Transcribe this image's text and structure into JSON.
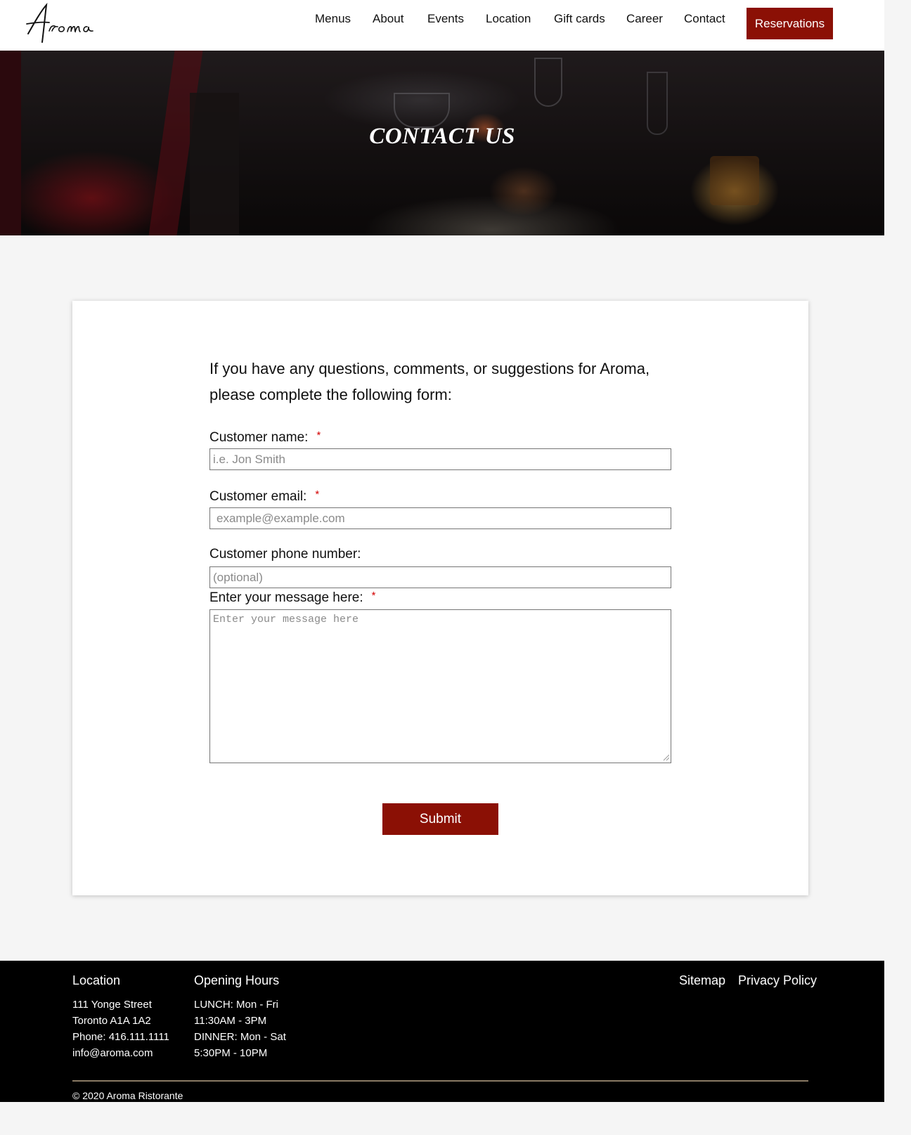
{
  "header": {
    "logo_text": "Aroma",
    "nav": [
      {
        "label": "Menus"
      },
      {
        "label": "About"
      },
      {
        "label": "Events"
      },
      {
        "label": "Location"
      },
      {
        "label": "Gift cards"
      },
      {
        "label": "Career"
      },
      {
        "label": "Contact"
      }
    ],
    "reserve_label": "Reservations"
  },
  "hero": {
    "title": "CONTACT US"
  },
  "form": {
    "intro": "If you have any questions, comments, or suggestions for Aroma, please complete the following form:",
    "required_mark": "*",
    "name": {
      "label": "Customer name:",
      "placeholder": "i.e. Jon Smith"
    },
    "email": {
      "label": "Customer email:",
      "placeholder": "example@example.com"
    },
    "phone": {
      "label": "Customer phone number:",
      "placeholder": "(optional)"
    },
    "message": {
      "label": "Enter your message here:",
      "placeholder": "Enter your message here"
    },
    "submit_label": "Submit"
  },
  "footer": {
    "location": {
      "heading": "Location",
      "lines": [
        "111 Yonge Street",
        "Toronto A1A 1A2",
        "Phone: 416.111.1111",
        "info@aroma.com"
      ]
    },
    "hours": {
      "heading": "Opening Hours",
      "lines": [
        "LUNCH: Mon - Fri",
        "11:30AM - 3PM",
        "DINNER: Mon - Sat",
        "5:30PM - 10PM"
      ]
    },
    "links": [
      {
        "label": "Sitemap"
      },
      {
        "label": "Privacy Policy"
      }
    ],
    "copyright": "© 2020 Aroma Ristorante"
  },
  "colors": {
    "accent": "#8b1005",
    "required": "#d30000",
    "page_bg": "#f5f5f5",
    "footer_bg": "#000000"
  }
}
